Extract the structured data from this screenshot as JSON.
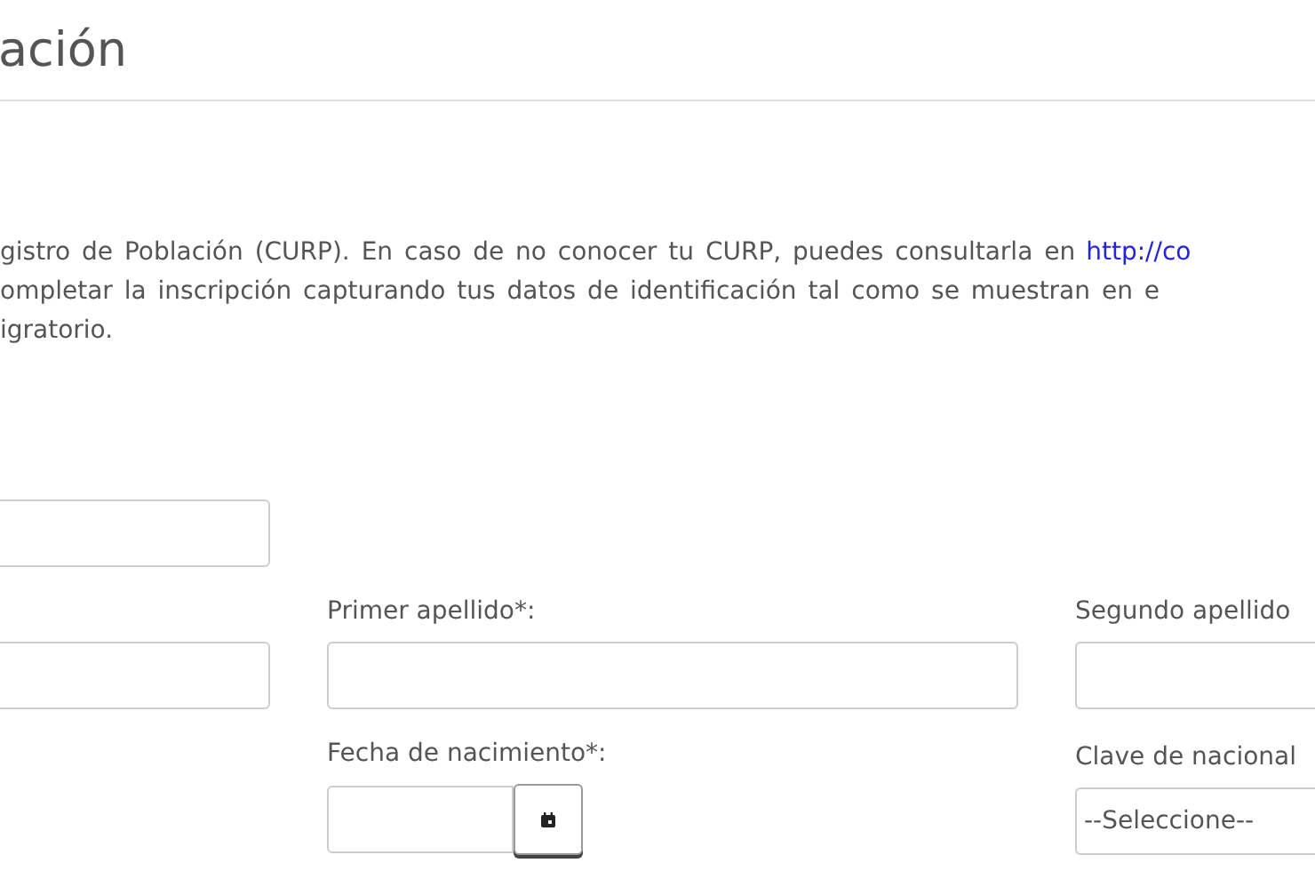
{
  "page_title": "ación",
  "intro": {
    "lines": [
      "gistro de Población (CURP). En caso de no conocer tu CURP, puedes consultarla en ",
      "ompletar la inscripción capturando tus datos de identificación tal como se muestran en e",
      "igratorio."
    ],
    "link": "http://co"
  },
  "form": {
    "rows": [
      {
        "fields": [
          {
            "kind": "text"
          }
        ]
      },
      {
        "fields": [
          {
            "kind": "text"
          },
          {
            "kind": "text",
            "label": "Primer apellido*:"
          },
          {
            "kind": "text",
            "label": "Segundo apellido"
          }
        ]
      },
      {
        "fields": [
          {
            "kind": "empty"
          },
          {
            "kind": "date",
            "label": "Fecha de nacimiento*:"
          },
          {
            "kind": "select",
            "label": "Clave de nacional",
            "value": "--Seleccione--"
          }
        ]
      }
    ]
  }
}
